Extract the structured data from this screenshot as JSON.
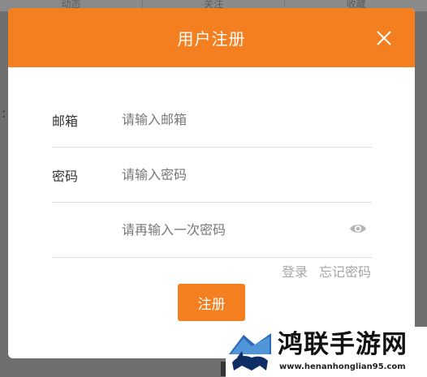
{
  "background": {
    "tabs": [
      "动态",
      "关注",
      "收藏"
    ]
  },
  "dialog": {
    "title": "用户注册",
    "fields": [
      {
        "label": "邮箱",
        "placeholder": "请输入邮箱",
        "value": ""
      },
      {
        "label": "密码",
        "placeholder": "请输入密码",
        "value": ""
      },
      {
        "label": "",
        "placeholder": "请再输入一次密码",
        "value": ""
      }
    ],
    "links": {
      "login": "登录",
      "forgot": "忘记密码"
    },
    "submit_label": "注册",
    "icons": {
      "close": "close-icon",
      "eye": "eye-icon"
    }
  },
  "watermark": {
    "name": "鸿联手游网",
    "url": "www.henanhonglian95.com"
  },
  "colors": {
    "accent": "#f47f20",
    "link": "#a5a5a5",
    "overlay": "#6f6f6f"
  }
}
